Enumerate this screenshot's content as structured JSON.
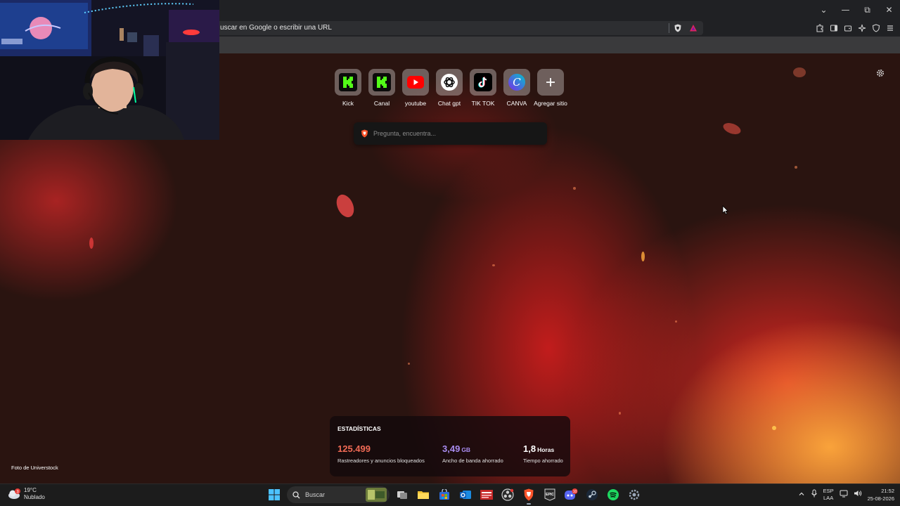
{
  "browser": {
    "url_placeholder": "uscar en Google o escribir una URL",
    "window_controls": [
      "chevron-down-icon",
      "minimize-icon",
      "restore-icon",
      "close-icon"
    ]
  },
  "ntp": {
    "tiles": [
      {
        "label": "Kick",
        "icon": "kick-icon"
      },
      {
        "label": "Canal",
        "icon": "kick-icon"
      },
      {
        "label": "youtube",
        "icon": "youtube-icon"
      },
      {
        "label": "Chat gpt",
        "icon": "chatgpt-icon"
      },
      {
        "label": "TIK TOK",
        "icon": "tiktok-icon"
      },
      {
        "label": "CANVA",
        "icon": "canva-icon"
      },
      {
        "label": "Agregar sitio",
        "icon": "plus-icon"
      }
    ],
    "search_placeholder": "Pregunta, encuentra...",
    "photo_credit": "Foto de Universtock",
    "stats": {
      "title": "ESTADÍSTICAS",
      "trackers": {
        "value": "125.499",
        "label": "Rastreadores y anuncios bloqueados",
        "color": "#f06a55"
      },
      "bandwidth": {
        "value": "3,49",
        "unit": "GB",
        "label": "Ancho de banda ahorrado",
        "color": "#a98cf0"
      },
      "time": {
        "value": "1,8",
        "unit": "Horas",
        "label": "Tiempo ahorrado",
        "color": "#ffffff"
      }
    }
  },
  "taskbar": {
    "weather": {
      "temp": "19°C",
      "condition": "Nublado",
      "badge": "3"
    },
    "search_label": "Buscar",
    "language": {
      "lang": "ESP",
      "layout": "LAA"
    },
    "clock": {
      "time": "21:52",
      "date": "25-08-2026"
    },
    "discord_badge": "10"
  }
}
